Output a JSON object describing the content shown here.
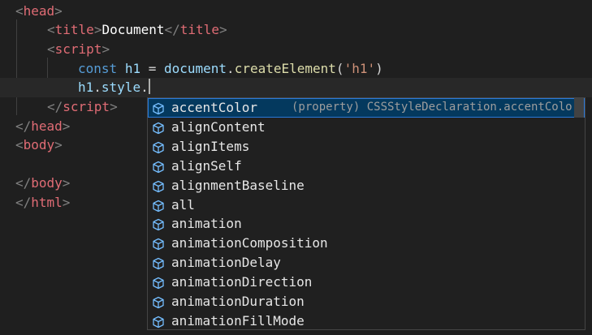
{
  "editor": {
    "lines": [
      {
        "id": "l1",
        "parts": [
          {
            "c": "t-bracket",
            "t": "<"
          },
          {
            "c": "t-head",
            "t": "head"
          },
          {
            "c": "t-bracket",
            "t": ">"
          }
        ]
      },
      {
        "id": "l2",
        "parts": [
          {
            "c": "t-bracket",
            "t": "<"
          },
          {
            "c": "t-head",
            "t": "title"
          },
          {
            "c": "t-bracket",
            "t": ">"
          },
          {
            "c": "t-text",
            "t": "Document"
          },
          {
            "c": "t-bracket",
            "t": "</"
          },
          {
            "c": "t-head",
            "t": "title"
          },
          {
            "c": "t-bracket",
            "t": ">"
          }
        ]
      },
      {
        "id": "l3",
        "parts": [
          {
            "c": "t-bracket",
            "t": "<"
          },
          {
            "c": "t-head",
            "t": "script"
          },
          {
            "c": "t-bracket",
            "t": ">"
          }
        ]
      },
      {
        "id": "l4",
        "parts": [
          {
            "c": "t-kw",
            "t": "const"
          },
          {
            "c": "t-op",
            "t": " "
          },
          {
            "c": "t-var",
            "t": "h1"
          },
          {
            "c": "t-op",
            "t": " = "
          },
          {
            "c": "t-var",
            "t": "document"
          },
          {
            "c": "t-op",
            "t": "."
          },
          {
            "c": "t-fn",
            "t": "createElement"
          },
          {
            "c": "t-op",
            "t": "("
          },
          {
            "c": "t-str",
            "t": "'h1'"
          },
          {
            "c": "t-op",
            "t": ")"
          }
        ]
      },
      {
        "id": "l5",
        "parts": [
          {
            "c": "t-var",
            "t": "h1"
          },
          {
            "c": "t-op",
            "t": "."
          },
          {
            "c": "t-var",
            "t": "style"
          },
          {
            "c": "t-op",
            "t": "."
          }
        ]
      },
      {
        "id": "l6",
        "parts": [
          {
            "c": "t-bracket",
            "t": "</"
          },
          {
            "c": "t-head",
            "t": "script"
          },
          {
            "c": "t-bracket",
            "t": ">"
          }
        ]
      },
      {
        "id": "l7",
        "parts": [
          {
            "c": "t-bracket",
            "t": "</"
          },
          {
            "c": "t-head",
            "t": "head"
          },
          {
            "c": "t-bracket",
            "t": ">"
          }
        ]
      },
      {
        "id": "l8",
        "parts": [
          {
            "c": "t-bracket",
            "t": "<"
          },
          {
            "c": "t-head",
            "t": "body"
          },
          {
            "c": "t-bracket",
            "t": ">"
          }
        ]
      },
      {
        "id": "l9",
        "parts": []
      },
      {
        "id": "l10",
        "parts": [
          {
            "c": "t-bracket",
            "t": "</"
          },
          {
            "c": "t-head",
            "t": "body"
          },
          {
            "c": "t-bracket",
            "t": ">"
          }
        ]
      },
      {
        "id": "l11",
        "parts": [
          {
            "c": "t-bracket",
            "t": "</"
          },
          {
            "c": "t-head",
            "t": "html"
          },
          {
            "c": "t-bracket",
            "t": ">"
          }
        ]
      }
    ]
  },
  "suggest": {
    "selected_detail": "(property) CSSStyleDeclaration.accentColo…",
    "item_icon": "cube-icon",
    "items": [
      "accentColor",
      "alignContent",
      "alignItems",
      "alignSelf",
      "alignmentBaseline",
      "all",
      "animation",
      "animationComposition",
      "animationDelay",
      "animationDirection",
      "animationDuration",
      "animationFillMode"
    ]
  },
  "colors": {
    "background": "#1f1f1f",
    "tag": "#e06c75",
    "keyword": "#569cd6",
    "function": "#dcdcaa",
    "string": "#ce9178",
    "selection": "#04395e"
  }
}
